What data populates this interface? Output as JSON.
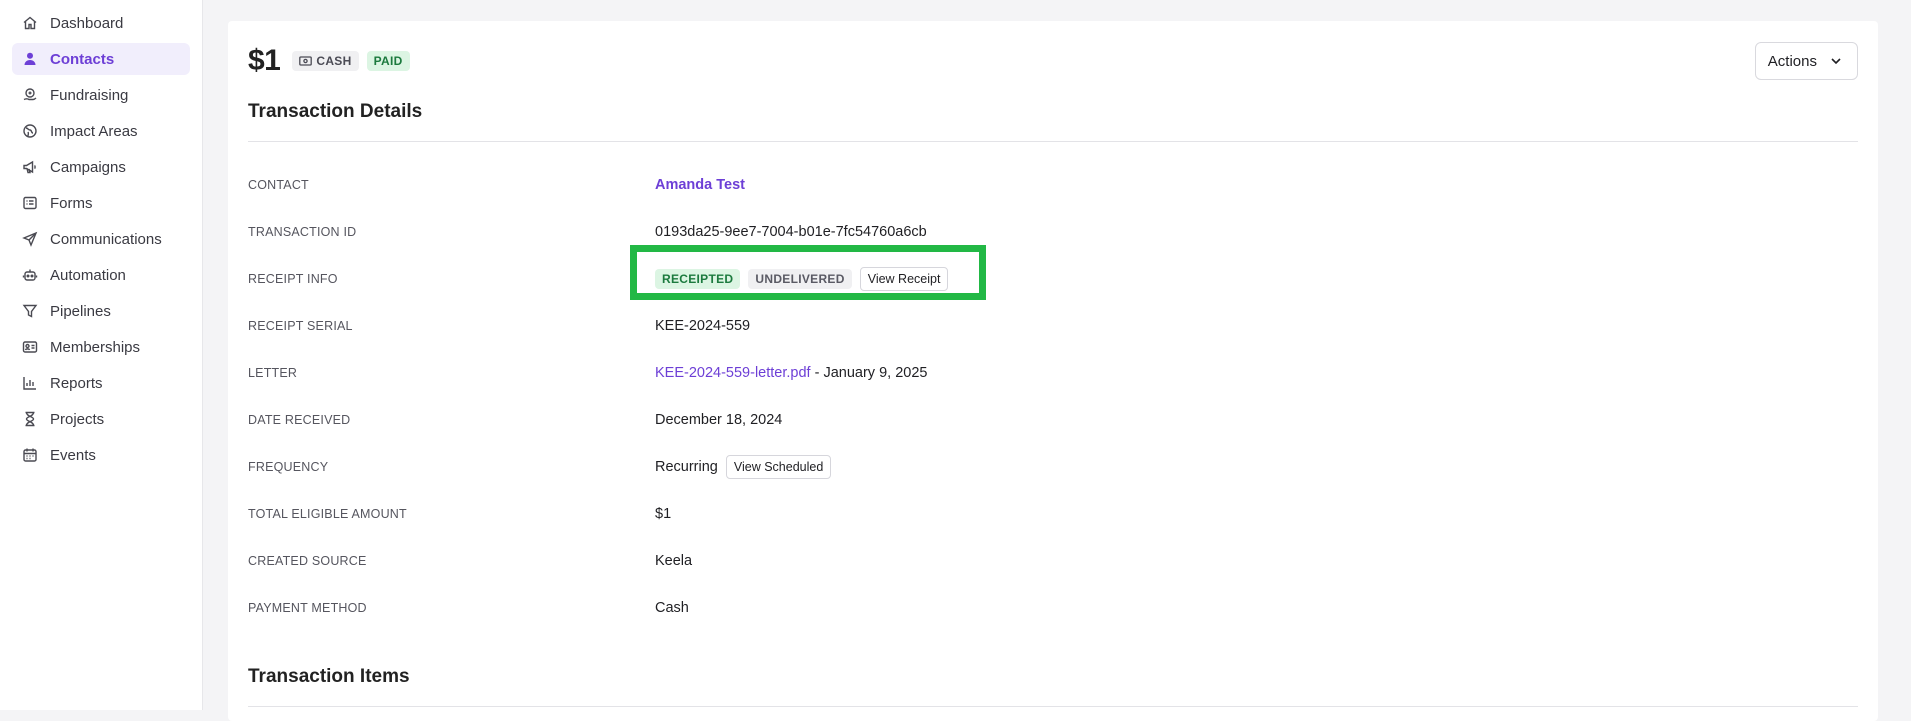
{
  "sidebar": {
    "items": [
      {
        "label": "Dashboard",
        "icon": "home-icon",
        "active": false
      },
      {
        "label": "Contacts",
        "icon": "person-icon",
        "active": true
      },
      {
        "label": "Fundraising",
        "icon": "donation-icon",
        "active": false
      },
      {
        "label": "Impact Areas",
        "icon": "globe-icon",
        "active": false
      },
      {
        "label": "Campaigns",
        "icon": "megaphone-icon",
        "active": false
      },
      {
        "label": "Forms",
        "icon": "form-icon",
        "active": false
      },
      {
        "label": "Communications",
        "icon": "paper-plane-icon",
        "active": false
      },
      {
        "label": "Automation",
        "icon": "robot-icon",
        "active": false
      },
      {
        "label": "Pipelines",
        "icon": "filter-icon",
        "active": false
      },
      {
        "label": "Memberships",
        "icon": "id-card-icon",
        "active": false
      },
      {
        "label": "Reports",
        "icon": "bar-chart-icon",
        "active": false
      },
      {
        "label": "Projects",
        "icon": "hourglass-icon",
        "active": false
      },
      {
        "label": "Events",
        "icon": "calendar-icon",
        "active": false
      }
    ]
  },
  "header": {
    "amount": "$1",
    "method_badge": "CASH",
    "status_badge": "PAID",
    "actions_label": "Actions"
  },
  "sections": {
    "details_title": "Transaction Details",
    "items_title": "Transaction Items"
  },
  "details": {
    "contact_label": "CONTACT",
    "contact_value": "Amanda Test",
    "transaction_id_label": "TRANSACTION ID",
    "transaction_id_value": "0193da25-9ee7-7004-b01e-7fc54760a6cb",
    "receipt_info_label": "RECEIPT INFO",
    "receipt_status_badge": "RECEIPTED",
    "delivery_status_badge": "UNDELIVERED",
    "view_receipt_label": "View Receipt",
    "receipt_serial_label": "RECEIPT SERIAL",
    "receipt_serial_value": "KEE-2024-559",
    "letter_label": "LETTER",
    "letter_file": "KEE-2024-559-letter.pdf",
    "letter_date": " - January 9, 2025",
    "date_received_label": "DATE RECEIVED",
    "date_received_value": "December 18, 2024",
    "frequency_label": "FREQUENCY",
    "frequency_value": "Recurring",
    "view_scheduled_label": "View Scheduled",
    "eligible_amount_label": "TOTAL ELIGIBLE AMOUNT",
    "eligible_amount_value": "$1",
    "created_source_label": "CREATED SOURCE",
    "created_source_value": "Keela",
    "payment_method_label": "PAYMENT METHOD",
    "payment_method_value": "Cash"
  },
  "colors": {
    "accent": "#6d3fd6",
    "highlight": "#22b845",
    "paid_bg": "#dcf5e3",
    "paid_text": "#1c7a3e"
  }
}
